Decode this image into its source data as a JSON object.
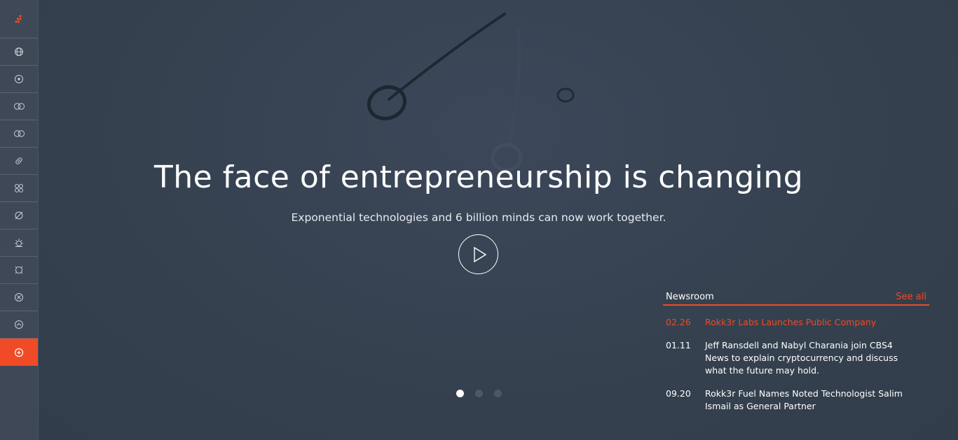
{
  "colors": {
    "accent": "#f04a26",
    "background": "#34404f",
    "sidebar": "#3e4856"
  },
  "sidebar": {
    "logo_icon": "dots-logo-icon",
    "items": [
      {
        "icon": "globe-icon"
      },
      {
        "icon": "target-icon"
      },
      {
        "icon": "double-ring-icon"
      },
      {
        "icon": "linked-rings-icon"
      },
      {
        "icon": "link-icon"
      },
      {
        "icon": "grid-circles-icon"
      },
      {
        "icon": "no-entry-icon"
      },
      {
        "icon": "sun-icon"
      },
      {
        "icon": "clock-icon"
      },
      {
        "icon": "cross-circle-icon"
      },
      {
        "icon": "chevron-up-circle-icon"
      },
      {
        "icon": "plus-circle-icon",
        "active": true
      }
    ]
  },
  "hero": {
    "headline": "The face of entrepreneurship is changing",
    "subheadline": "Exponential technologies and 6 billion minds can now work together.",
    "play_icon": "play-icon",
    "slides": 3,
    "active_slide": 1
  },
  "newsroom": {
    "title": "Newsroom",
    "see_all": "See all",
    "items": [
      {
        "date": "02.26",
        "text": "Rokk3r Labs Launches Public Company",
        "highlight": true
      },
      {
        "date": "01.11",
        "text": "Jeff Ransdell and Nabyl Charania join CBS4 News to explain cryptocurrency and discuss what the future may hold."
      },
      {
        "date": "09.20",
        "text": "Rokk3r Fuel Names Noted Technologist Salim Ismail as General Partner"
      }
    ]
  }
}
